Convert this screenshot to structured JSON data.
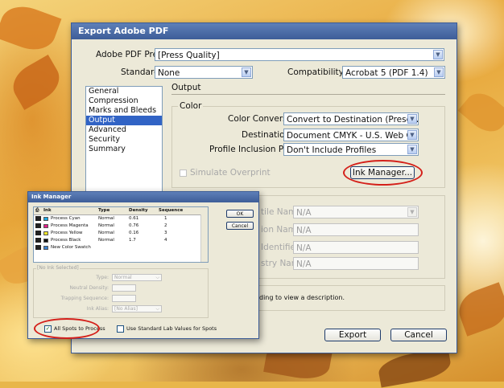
{
  "dialog": {
    "title": "Export Adobe PDF",
    "preset_label": "Adobe PDF Preset:",
    "preset_value": "[Press Quality]",
    "standard_label": "Standard:",
    "standard_value": "None",
    "compat_label": "Compatibility:",
    "compat_value": "Acrobat 5 (PDF 1.4)",
    "nav": [
      "General",
      "Compression",
      "Marks and Bleeds",
      "Output",
      "Advanced",
      "Security",
      "Summary"
    ],
    "nav_selected_index": 3,
    "section_title": "Output",
    "color_group": "Color",
    "color_conversion_label": "Color Conversion:",
    "color_conversion_value": "Convert to Destination (Preserve Numb",
    "destination_label": "Destination:",
    "destination_value": "Document CMYK - U.S. Web Coated (S",
    "profile_label": "Profile Inclusion Policy:",
    "profile_value": "Don't Include Profiles",
    "simulate_overprint": "Simulate Overprint",
    "ink_manager_button": "Ink Manager...",
    "pdfx": {
      "profile_name_label": "tile Name:",
      "profile_name_value": "N/A",
      "condition_name_label": "ion Name:",
      "condition_name_value": "N/A",
      "identifier_label": "Identifier:",
      "identifier_value": "N/A",
      "registry_label": "stry Name:",
      "registry_value": "N/A"
    },
    "description_text": "ding to view a description.",
    "export_button": "Export",
    "cancel_button": "Cancel"
  },
  "ink_manager": {
    "title": "Ink Manager",
    "columns": [
      "Ink",
      "Type",
      "Density",
      "Sequence"
    ],
    "rows": [
      {
        "ink": "Process Cyan",
        "type": "Normal",
        "density": "0.61",
        "sequence": "1",
        "color": "#20a8e0"
      },
      {
        "ink": "Process Magenta",
        "type": "Normal",
        "density": "0.76",
        "sequence": "2",
        "color": "#e0208a"
      },
      {
        "ink": "Process Yellow",
        "type": "Normal",
        "density": "0.16",
        "sequence": "3",
        "color": "#f2e52a"
      },
      {
        "ink": "Process Black",
        "type": "Normal",
        "density": "1.7",
        "sequence": "4",
        "color": "#111111"
      },
      {
        "ink": "New Color Swatch",
        "type": "",
        "density": "",
        "sequence": "",
        "color": "#3a7fd0"
      }
    ],
    "ok_button": "OK",
    "cancel_button": "Cancel",
    "no_ink_label": "[No Ink Selected]",
    "type_label": "Type:",
    "type_value": "Normal",
    "density_label": "Neutral Density:",
    "trapping_label": "Trapping Sequence:",
    "alias_label": "Ink Alias:",
    "alias_value": "[No Alias]",
    "all_spots": "All Spots to Process",
    "use_lab": "Use Standard Lab Values for Spots"
  }
}
